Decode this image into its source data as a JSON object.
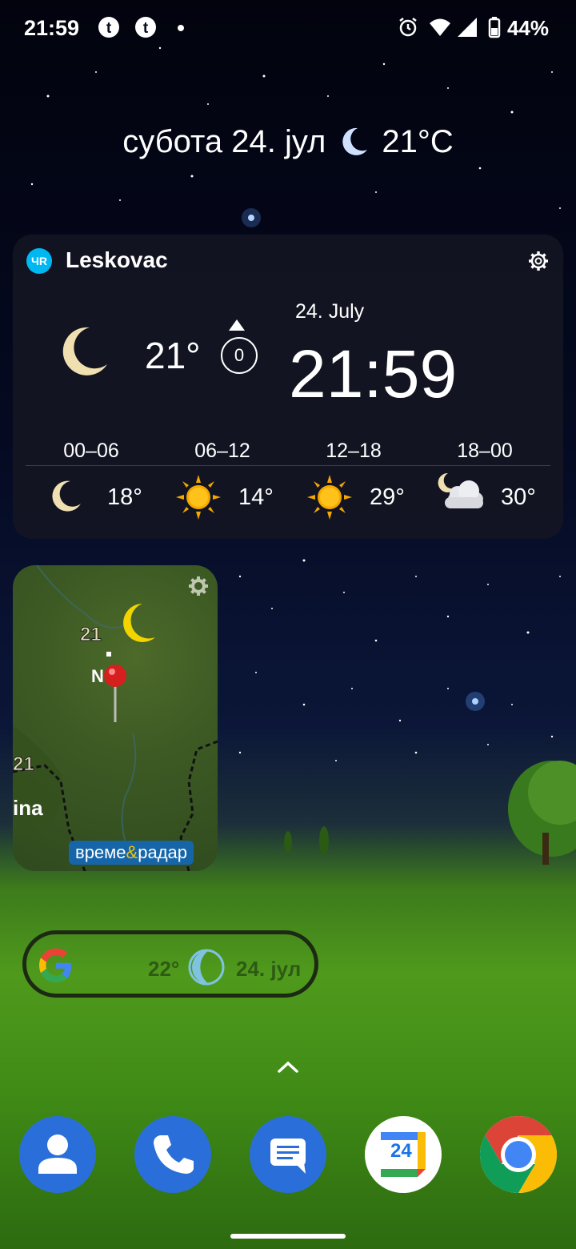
{
  "status_bar": {
    "time": "21:59",
    "battery": "44%"
  },
  "date_line": {
    "date": "субота 24. јул",
    "temperature": "21°C"
  },
  "weather_widget": {
    "city": "Leskovac",
    "logo_text": "ЧR",
    "now_temp": "21°",
    "wind": "0",
    "date": "24. July",
    "time": "21:59",
    "periods": [
      {
        "label": "00–06",
        "temp": "18°",
        "icon": "moon-icon"
      },
      {
        "label": "06–12",
        "temp": "14°",
        "icon": "sun-icon"
      },
      {
        "label": "12–18",
        "temp": "29°",
        "icon": "sun-icon"
      },
      {
        "label": "18–00",
        "temp": "30°",
        "icon": "partly-cloudy-night-icon"
      }
    ]
  },
  "map_widget": {
    "logo_left": "време",
    "logo_amp": "&",
    "logo_right": "радар"
  },
  "google_widget": {
    "temp": "22°",
    "date": "24. јул"
  },
  "dock": [
    "contacts",
    "phone",
    "messages",
    "calendar",
    "chrome"
  ],
  "calendar_day": "24",
  "colors": {
    "accent_blue": "#2a6fd9",
    "yr_blue": "#00b8f1",
    "sun": "#f5a800",
    "moon": "#f0dfb0"
  }
}
